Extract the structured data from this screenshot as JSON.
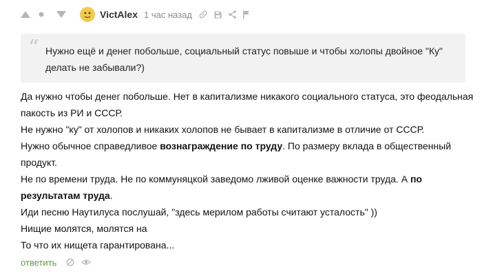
{
  "comment": {
    "author": "VictAlex",
    "time": "1 час назад",
    "quote": "Нужно ещё и денег побольше, социальный статус повыше и чтобы холопы двойное \"Ку\" делать не забывали?)",
    "lines": [
      {
        "parts": [
          {
            "text": "Да нужно чтобы денег побольше. Нет в капитализме никакого социального статуса, это феодальная пакость из РИ и СССР.",
            "bold": false
          }
        ]
      },
      {
        "parts": [
          {
            "text": "Не нужно \"ку\" от холопов и никаких холопов не бывает в капитализме в отличие от СССР.",
            "bold": false
          }
        ]
      },
      {
        "parts": [
          {
            "text": "Нужно обычное справедливое ",
            "bold": false
          },
          {
            "text": "вознаграждение по труду",
            "bold": true
          },
          {
            "text": ". По размеру вклада в общественный продукт.",
            "bold": false
          }
        ]
      },
      {
        "parts": [
          {
            "text": "Не по времени труда. Не по коммуняцкой заведомо лживой оценке важности труда. А ",
            "bold": false
          },
          {
            "text": "по результатам труда",
            "bold": true
          },
          {
            "text": ".",
            "bold": false
          }
        ]
      },
      {
        "parts": [
          {
            "text": "Иди песню Наутилуса послушай, \"здесь мерилом работы считают усталость\" ))",
            "bold": false
          }
        ]
      },
      {
        "parts": [
          {
            "text": "Нищие молятся, молятся на",
            "bold": false
          }
        ]
      },
      {
        "parts": [
          {
            "text": "То что их нищета гарантирована...",
            "bold": false
          }
        ]
      }
    ]
  },
  "actions": {
    "reply_label": "ответить"
  },
  "icons": {
    "upvote": "upvote-icon",
    "dot": "dot-icon",
    "downvote": "downvote-icon",
    "link": "link-icon",
    "save": "save-icon",
    "share": "share-icon",
    "report": "flag-icon",
    "hide": "hide-icon",
    "view": "eye-icon"
  },
  "colors": {
    "reply": "#5b9a3f",
    "quote_bg": "#f2f2f2",
    "icon": "#b5b5b5"
  }
}
